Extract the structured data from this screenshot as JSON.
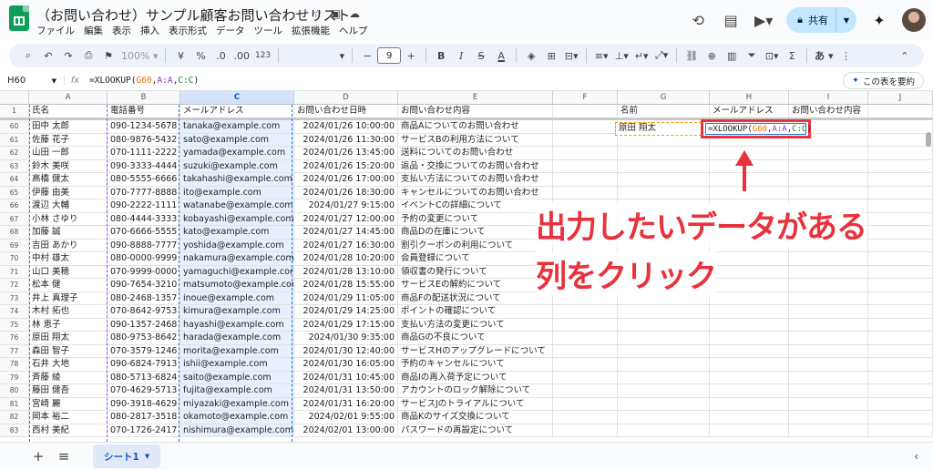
{
  "window": {
    "doc_title": "（お問い合わせ）サンプル顧客お問い合わせリスト",
    "menu": [
      "ファイル",
      "編集",
      "表示",
      "挿入",
      "表示形式",
      "データ",
      "ツール",
      "拡張機能",
      "ヘルプ"
    ],
    "share_label": "共有"
  },
  "toolbar": {
    "zoom": "100%",
    "currency": "¥",
    "percent": "%",
    "decimal_dec": ".0",
    "decimal_inc": ".00",
    "number_format": "123",
    "font_size": "9",
    "font_family_placeholder": "あ"
  },
  "formula_bar": {
    "cell_ref": "H60",
    "fx": "fx",
    "formula": "=XLOOKUP(G60,A:A,C:C)",
    "summary_button": "この表を要約"
  },
  "columns": [
    "A",
    "B",
    "C",
    "D",
    "E",
    "F",
    "G",
    "H",
    "I",
    "J"
  ],
  "header_row": {
    "num": "1",
    "cells": [
      "氏名",
      "電話番号",
      "メールアドレス",
      "お問い合わせ日時",
      "お問い合わせ内容",
      "",
      "名前",
      "メールアドレス",
      "お問い合わせ内容",
      ""
    ]
  },
  "rows": [
    {
      "n": "60",
      "name": "田中 太郎",
      "tel": "090-1234-5678",
      "mail": "tanaka@example.com",
      "date": "2024/01/26 10:00:00",
      "content": "商品Aについてのお問い合わせ"
    },
    {
      "n": "61",
      "name": "佐藤 花子",
      "tel": "080-9876-5432",
      "mail": "sato@example.com",
      "date": "2024/01/26 11:30:00",
      "content": "サービスBの利用方法について"
    },
    {
      "n": "62",
      "name": "山田 一郎",
      "tel": "070-1111-2222",
      "mail": "yamada@example.com",
      "date": "2024/01/26 13:45:00",
      "content": "送料についてのお問い合わせ"
    },
    {
      "n": "63",
      "name": "鈴木 美咲",
      "tel": "090-3333-4444",
      "mail": "suzuki@example.com",
      "date": "2024/01/26 15:20:00",
      "content": "返品・交換についてのお問い合わせ"
    },
    {
      "n": "64",
      "name": "高橋 健太",
      "tel": "080-5555-6666",
      "mail": "takahashi@example.com",
      "date": "2024/01/26 17:00:00",
      "content": "支払い方法についてのお問い合わせ"
    },
    {
      "n": "65",
      "name": "伊藤 由美",
      "tel": "070-7777-8888",
      "mail": "ito@example.com",
      "date": "2024/01/26 18:30:00",
      "content": "キャンセルについてのお問い合わせ"
    },
    {
      "n": "66",
      "name": "渡辺 大輔",
      "tel": "090-2222-1111",
      "mail": "watanabe@example.com",
      "date": "2024/01/27 9:15:00",
      "content": "イベントCの詳細について"
    },
    {
      "n": "67",
      "name": "小林 さゆり",
      "tel": "080-4444-3333",
      "mail": "kobayashi@example.com",
      "date": "2024/01/27 12:00:00",
      "content": "予約の変更について"
    },
    {
      "n": "68",
      "name": "加藤 誠",
      "tel": "070-6666-5555",
      "mail": "kato@example.com",
      "date": "2024/01/27 14:45:00",
      "content": "商品Dの在庫について"
    },
    {
      "n": "69",
      "name": "吉田 あかり",
      "tel": "090-8888-7777",
      "mail": "yoshida@example.com",
      "date": "2024/01/27 16:30:00",
      "content": "割引クーポンの利用について"
    },
    {
      "n": "70",
      "name": "中村 雄太",
      "tel": "080-0000-9999",
      "mail": "nakamura@example.com",
      "date": "2024/01/28 10:20:00",
      "content": "会員登録について"
    },
    {
      "n": "71",
      "name": "山口 美穂",
      "tel": "070-9999-0000",
      "mail": "yamaguchi@example.com",
      "date": "2024/01/28 13:10:00",
      "content": "領収書の発行について"
    },
    {
      "n": "72",
      "name": "松本 健",
      "tel": "090-7654-3210",
      "mail": "matsumoto@example.com",
      "date": "2024/01/28 15:55:00",
      "content": "サービスEの解約について"
    },
    {
      "n": "73",
      "name": "井上 真理子",
      "tel": "080-2468-1357",
      "mail": "inoue@example.com",
      "date": "2024/01/29 11:05:00",
      "content": "商品Fの配送状況について"
    },
    {
      "n": "74",
      "name": "木村 拓也",
      "tel": "070-8642-9753",
      "mail": "kimura@example.com",
      "date": "2024/01/29 14:25:00",
      "content": "ポイントの確認について"
    },
    {
      "n": "75",
      "name": "林 恵子",
      "tel": "090-1357-2468",
      "mail": "hayashi@example.com",
      "date": "2024/01/29 17:15:00",
      "content": "支払い方法の変更について"
    },
    {
      "n": "76",
      "name": "原田 翔太",
      "tel": "080-9753-8642",
      "mail": "harada@example.com",
      "date": "2024/01/30 9:35:00",
      "content": "商品Gの不良について"
    },
    {
      "n": "77",
      "name": "森田 智子",
      "tel": "070-3579-1246",
      "mail": "morita@example.com",
      "date": "2024/01/30 12:40:00",
      "content": "サービスHのアップグレードについて"
    },
    {
      "n": "78",
      "name": "石井 大地",
      "tel": "090-6824-7913",
      "mail": "ishii@example.com",
      "date": "2024/01/30 16:05:00",
      "content": "予約のキャンセルについて"
    },
    {
      "n": "79",
      "name": "斉藤 綾",
      "tel": "080-5713-6824",
      "mail": "saito@example.com",
      "date": "2024/01/31 10:45:00",
      "content": "商品Iの再入荷予定について"
    },
    {
      "n": "80",
      "name": "藤田 健吾",
      "tel": "070-4629-5713",
      "mail": "fujita@example.com",
      "date": "2024/01/31 13:50:00",
      "content": "アカウントのロック解除について"
    },
    {
      "n": "81",
      "name": "宮崎 麗",
      "tel": "090-3918-4629",
      "mail": "miyazaki@example.com",
      "date": "2024/01/31 16:20:00",
      "content": "サービスJのトライアルについて"
    },
    {
      "n": "82",
      "name": "岡本 裕二",
      "tel": "080-2817-3518",
      "mail": "okamoto@example.com",
      "date": "2024/02/01 9:55:00",
      "content": "商品Kのサイズ交換について"
    },
    {
      "n": "83",
      "name": "西村 美紀",
      "tel": "070-1726-2417",
      "mail": "nishimura@example.com",
      "date": "2024/02/01 13:00:00",
      "content": "パスワードの再設定について"
    }
  ],
  "lookup": {
    "g60": "原田 翔太",
    "formula_parts": [
      "=XLOOKUP(",
      "G60",
      ",",
      "A:A",
      ",",
      "C:C",
      ")"
    ]
  },
  "annotation": {
    "line1": "出力したいデータがある",
    "line2": "列をクリック"
  },
  "sheet_tab": "シート1"
}
